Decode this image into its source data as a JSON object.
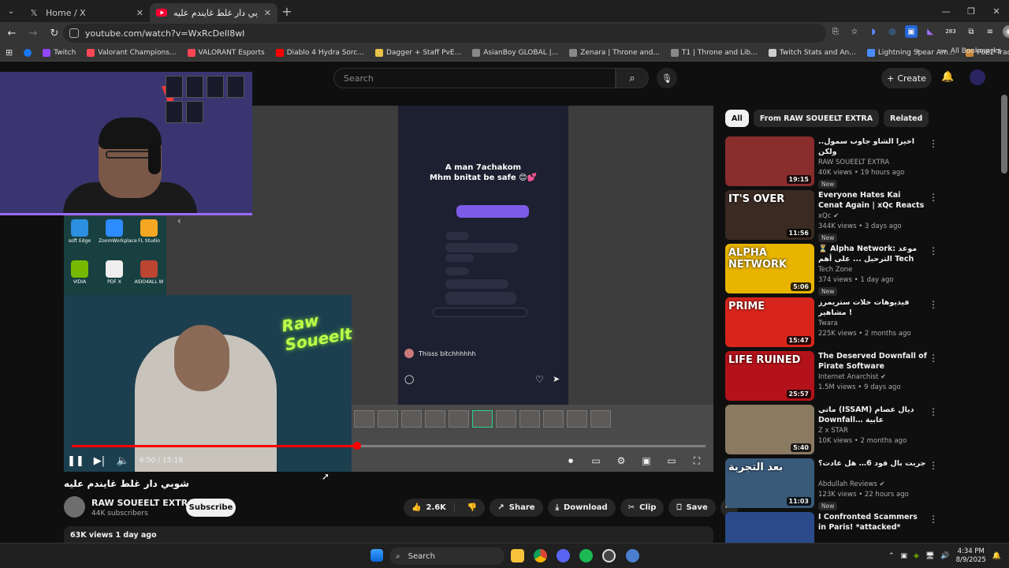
{
  "browser": {
    "tabs": [
      {
        "title": "Home / X",
        "icon": "x-logo-icon",
        "active": false
      },
      {
        "title": "شوبي دار غلط غايندم عليه -",
        "icon": "youtube-icon",
        "active": true
      }
    ],
    "new_tab": "+",
    "window": {
      "minimize": "—",
      "maximize": "❐",
      "close": "✕"
    },
    "url": "youtube.com/watch?v=WxRcDeIl8wI",
    "extension_badge": "283",
    "bookmarks": [
      {
        "label": "Twitch",
        "color": "#9146ff"
      },
      {
        "label": "Valorant Champions...",
        "color": "#ff4655"
      },
      {
        "label": "VALORANT Esports",
        "color": "#ff4655"
      },
      {
        "label": "Diablo 4 Hydra Sorc...",
        "color": "#ff0000"
      },
      {
        "label": "Dagger + Staff PvE...",
        "color": "#e8c24a"
      },
      {
        "label": "AsianBoy GLOBAL |...",
        "color": "#888888"
      },
      {
        "label": "Zenara | Throne and...",
        "color": "#888888"
      },
      {
        "label": "T1 | Throne and Lib...",
        "color": "#888888"
      },
      {
        "label": "Twitch Stats and An...",
        "color": "#cccccc"
      },
      {
        "label": "Lightning Spear Am...",
        "color": "#4a8cff"
      },
      {
        "label": "PoE2 Trade - Path of...",
        "color": "#c8883a"
      }
    ],
    "all_bookmarks": "All Bookmarks"
  },
  "youtube": {
    "search_placeholder": "Search",
    "create_label": "Create",
    "player": {
      "phone_title_line1": "A man 7achakom",
      "phone_title_line2": "Mhm bnitat be safe 😊💕",
      "phone_reply": "Thisss bitchhhhhh",
      "desktop_icons": [
        "soft Edge",
        "ZoomWorkplace",
        "FL Studio",
        "VIDIA",
        "PDF X",
        "ASIO4ALL W"
      ],
      "neon_sign": "Raw Soueelt",
      "time_current": "6:50",
      "time_total": "15:18",
      "progress_fraction": 0.45
    },
    "video": {
      "title": "شوبي دار غلط غايندم عليه",
      "channel": "RAW SOUEELT EXTRA",
      "subscribers": "44K subscribers",
      "subscribe_label": "Subscribe",
      "likes": "2.6K",
      "share_label": "Share",
      "download_label": "Download",
      "clip_label": "Clip",
      "save_label": "Save",
      "views_line": "63K views  1 day ago"
    },
    "chips": [
      "All",
      "From RAW SOUEELT EXTRA",
      "Related"
    ],
    "recommendations": [
      {
        "title": "اخيرا الشاو جاوب سمول.. ولكن",
        "channel": "RAW SOUEELT EXTRA",
        "meta": "40K views • 19 hours ago",
        "duration": "19:15",
        "new": "New",
        "color": "#8a2d2d",
        "caption": ""
      },
      {
        "title": "Everyone Hates Kai Cenat Again | xQc Reacts",
        "channel": "xQc ✔",
        "meta": "344K views • 3 days ago",
        "duration": "11:56",
        "new": "New",
        "color": "#3a2a22",
        "caption": "IT'S OVER"
      },
      {
        "title": "⏳ Alpha Network: موعد الترحيل ... على أهم Tech Zone الثالث ورد",
        "channel": "Tech Zone",
        "meta": "374 views • 1 day ago",
        "duration": "5:06",
        "new": "New",
        "color": "#e8b400",
        "caption": "ALPHA NETWORK"
      },
      {
        "title": "فيديوهات خلات ستريمرز مشاهير !",
        "channel": "Twara",
        "meta": "225K views • 2 months ago",
        "duration": "15:47",
        "new": "",
        "color": "#d8251c",
        "caption": "PRIME"
      },
      {
        "title": "The Deserved Downfall of Pirate Software",
        "channel": "Internet Anarchist ✔",
        "meta": "1.5M views • 9 days ago",
        "duration": "25:57",
        "new": "",
        "color": "#b3121a",
        "caption": "LIFE RUINED"
      },
      {
        "title": "ماتي (ISSAM) ديال عصام Downfall… عابية",
        "channel": "Z x STAR",
        "meta": "10K views • 2 months ago",
        "duration": "5:40",
        "new": "",
        "color": "#8a7a62",
        "caption": ""
      },
      {
        "title": "جربت بال فود 6… هل عادت؟",
        "channel": "Abdullah Reviews ✔",
        "meta": "123K views • 22 hours ago",
        "duration": "11:03",
        "new": "New",
        "color": "#3a5a7a",
        "caption": "بعد التجربة"
      },
      {
        "title": "I Confronted Scammers in Paris! *attacked*",
        "channel": "",
        "meta": "",
        "duration": "",
        "new": "",
        "color": "#2a4a8a",
        "caption": ""
      }
    ]
  },
  "taskbar": {
    "search_label": "Search",
    "time": "4:34 PM",
    "date": "8/9/2025"
  }
}
